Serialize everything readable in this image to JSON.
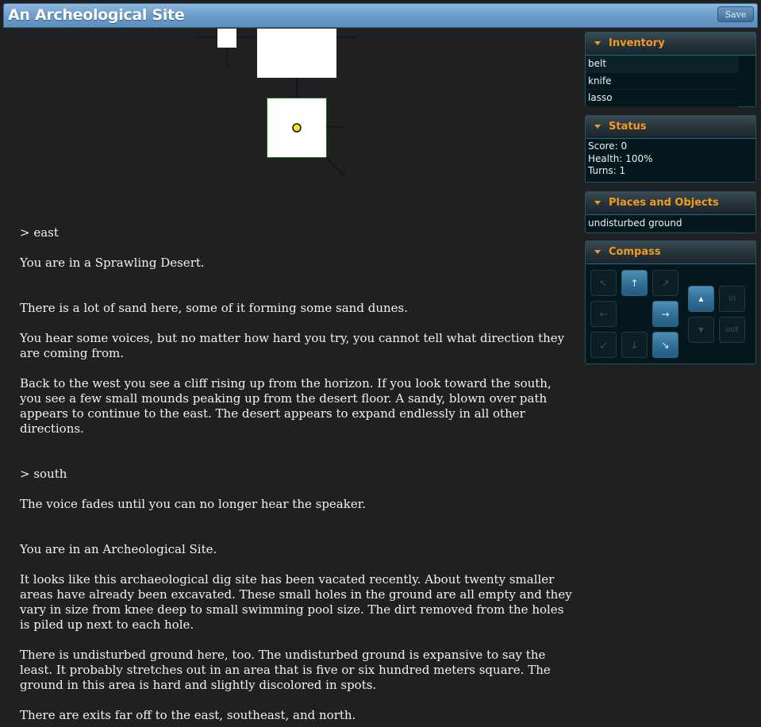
{
  "window": {
    "title": "An Archeological Site",
    "save_label": "Save"
  },
  "output": [
    {
      "kind": "cmd",
      "text": "> east"
    },
    {
      "kind": "p",
      "text": "You are in a Sprawling Desert."
    },
    {
      "kind": "gap"
    },
    {
      "kind": "p",
      "text": "There is a lot of sand here, some of it forming some sand dunes."
    },
    {
      "kind": "p",
      "text": "You hear some voices, but no matter how hard you try, you cannot tell what direction they are coming from."
    },
    {
      "kind": "p",
      "text": "Back to the west you see a cliff rising up from the horizon. If you look toward the south, you see a few small mounds peaking up from the desert floor. A sandy, blown over path appears to continue to the east. The desert appears to expand endlessly in all other directions."
    },
    {
      "kind": "gap"
    },
    {
      "kind": "cmd",
      "text": "> south"
    },
    {
      "kind": "p",
      "text": "The voice fades until you can no longer hear the speaker."
    },
    {
      "kind": "gap"
    },
    {
      "kind": "p",
      "text": "You are in an Archeological Site."
    },
    {
      "kind": "p",
      "text": "It looks like this archaeological dig site has been vacated recently. About twenty smaller areas have already been excavated. These small holes in the ground are all empty and they vary in size from knee deep to small swimming pool size. The dirt removed from the holes is piled up next to each hole."
    },
    {
      "kind": "p",
      "text": "There is undisturbed ground here, too. The undisturbed ground is expansive to say the least. It probably stretches out in an area that is five or six hundred meters square. The ground in this area is hard and slightly discolored in spots."
    },
    {
      "kind": "p",
      "text": "There are exits far off to the east, southeast, and north."
    }
  ],
  "inventory": {
    "title": "Inventory",
    "items": [
      "belt",
      "knife",
      "lasso"
    ]
  },
  "status": {
    "title": "Status",
    "lines": [
      "Score: 0",
      "Health: 100%",
      "Turns: 1"
    ]
  },
  "places": {
    "title": "Places and Objects",
    "items": [
      "undisturbed ground"
    ]
  },
  "compass": {
    "title": "Compass",
    "buttons": [
      {
        "name": "compass-northwest-button",
        "glyph": "↖",
        "enabled": false
      },
      {
        "name": "compass-north-button",
        "glyph": "↑",
        "enabled": true
      },
      {
        "name": "compass-northeast-button",
        "glyph": "↗",
        "enabled": false
      },
      {
        "name": "compass-west-button",
        "glyph": "←",
        "enabled": false
      },
      {
        "name": "compass-east-button",
        "glyph": "→",
        "enabled": true
      },
      {
        "name": "compass-southwest-button",
        "glyph": "↙",
        "enabled": false
      },
      {
        "name": "compass-south-button",
        "glyph": "↓",
        "enabled": false
      },
      {
        "name": "compass-southeast-button",
        "glyph": "↘",
        "enabled": true
      },
      {
        "name": "compass-up-button",
        "glyph": "▲",
        "enabled": true
      },
      {
        "name": "compass-in-button",
        "glyph": "in",
        "enabled": false
      },
      {
        "name": "compass-down-button",
        "glyph": "▼",
        "enabled": false
      },
      {
        "name": "compass-out-button",
        "glyph": "out",
        "enabled": false
      }
    ]
  },
  "colors": {
    "accent": "#f39a20",
    "background": "#1f2022",
    "player_marker": "#f5e21a"
  }
}
